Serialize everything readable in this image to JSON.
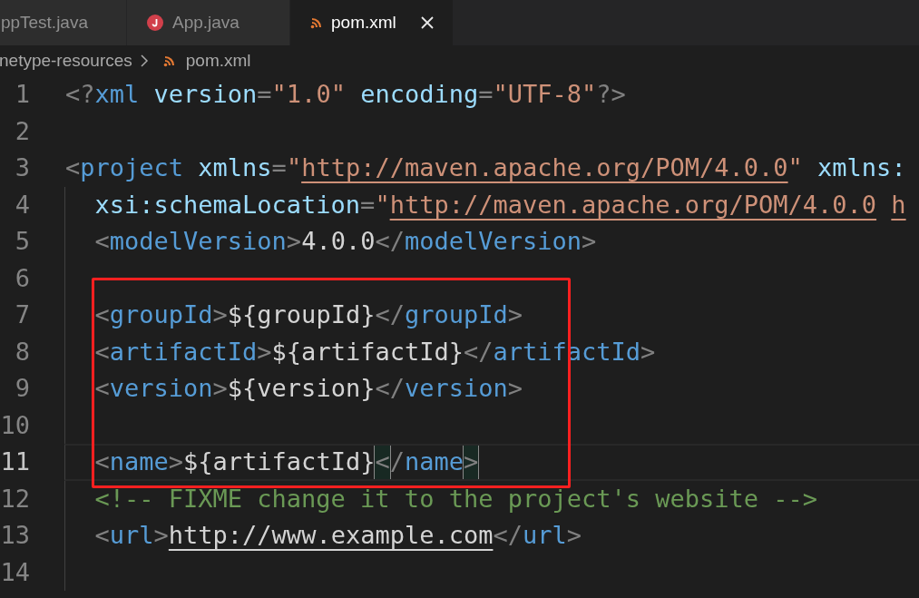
{
  "tabs": [
    {
      "label": "ppTest.java",
      "selected": false
    },
    {
      "label": "App.java",
      "selected": false
    },
    {
      "label": "pom.xml",
      "selected": true
    }
  ],
  "breadcrumb": {
    "folder": "netype-resources",
    "file": "pom.xml"
  },
  "lines": [
    {
      "number": "1",
      "current": false,
      "tokens": [
        {
          "kind": "bracket",
          "text": "<?"
        },
        {
          "kind": "tag",
          "text": "xml"
        },
        {
          "kind": "attr",
          "text": " version"
        },
        {
          "kind": "bracket",
          "text": "="
        },
        {
          "kind": "string",
          "text": "\"1.0\""
        },
        {
          "kind": "attr",
          "text": " encoding"
        },
        {
          "kind": "bracket",
          "text": "="
        },
        {
          "kind": "string",
          "text": "\"UTF-8\""
        },
        {
          "kind": "bracket",
          "text": "?>"
        }
      ]
    },
    {
      "number": "2",
      "current": false
    },
    {
      "number": "3",
      "current": false,
      "tokens": [
        {
          "kind": "bracket",
          "text": "<"
        },
        {
          "kind": "tag",
          "text": "project"
        },
        {
          "kind": "attr",
          "text": " xmlns"
        },
        {
          "kind": "bracket",
          "text": "="
        },
        {
          "kind": "string",
          "text": "\""
        },
        {
          "kind": "string",
          "text": "http://maven.apache.org/POM/4.0.0",
          "link": true
        },
        {
          "kind": "string",
          "text": "\""
        },
        {
          "kind": "attr",
          "text": " xmlns:"
        }
      ]
    },
    {
      "number": "4",
      "current": false,
      "tokens": [
        {
          "kind": "attr",
          "text": "  xsi:schemaLocation"
        },
        {
          "kind": "bracket",
          "text": "="
        },
        {
          "kind": "string",
          "text": "\""
        },
        {
          "kind": "string",
          "text": "http://maven.apache.org/POM/4.0.0 ",
          "link": true
        },
        {
          "kind": "string",
          "text": "h",
          "link": true
        }
      ]
    },
    {
      "number": "5",
      "current": false,
      "tokens": [
        {
          "kind": "bracket",
          "text": "  <"
        },
        {
          "kind": "tag",
          "text": "modelVersion"
        },
        {
          "kind": "bracket",
          "text": ">"
        },
        {
          "kind": "text",
          "text": "4.0.0"
        },
        {
          "kind": "bracket",
          "text": "</"
        },
        {
          "kind": "tag",
          "text": "modelVersion"
        },
        {
          "kind": "bracket",
          "text": ">"
        }
      ]
    },
    {
      "number": "6",
      "current": false
    },
    {
      "number": "7",
      "current": false,
      "tokens": [
        {
          "kind": "bracket",
          "text": "  <"
        },
        {
          "kind": "tag",
          "text": "groupId"
        },
        {
          "kind": "bracket",
          "text": ">"
        },
        {
          "kind": "text",
          "text": "${groupId}"
        },
        {
          "kind": "bracket",
          "text": "</"
        },
        {
          "kind": "tag",
          "text": "groupId"
        },
        {
          "kind": "bracket",
          "text": ">"
        }
      ]
    },
    {
      "number": "8",
      "current": false,
      "tokens": [
        {
          "kind": "bracket",
          "text": "  <"
        },
        {
          "kind": "tag",
          "text": "artifactId"
        },
        {
          "kind": "bracket",
          "text": ">"
        },
        {
          "kind": "text",
          "text": "${artifactId}"
        },
        {
          "kind": "bracket",
          "text": "</"
        },
        {
          "kind": "tag",
          "text": "artifactId"
        },
        {
          "kind": "bracket",
          "text": ">"
        }
      ]
    },
    {
      "number": "9",
      "current": false,
      "tokens": [
        {
          "kind": "bracket",
          "text": "  <"
        },
        {
          "kind": "tag",
          "text": "version"
        },
        {
          "kind": "bracket",
          "text": ">"
        },
        {
          "kind": "text",
          "text": "${version}"
        },
        {
          "kind": "bracket",
          "text": "</"
        },
        {
          "kind": "tag",
          "text": "version"
        },
        {
          "kind": "bracket",
          "text": ">"
        }
      ]
    },
    {
      "number": "10",
      "current": false
    },
    {
      "number": "11",
      "current": true,
      "tokens": [
        {
          "kind": "bracket",
          "text": "  <"
        },
        {
          "kind": "tag",
          "text": "name"
        },
        {
          "kind": "bracket",
          "text": ">"
        },
        {
          "kind": "text",
          "text": "${artifactId}"
        },
        {
          "kind": "bracket",
          "text": "<",
          "matched": true
        },
        {
          "kind": "bracket",
          "text": "/"
        },
        {
          "kind": "tag",
          "text": "name"
        },
        {
          "kind": "bracket",
          "text": ">",
          "matched": true
        }
      ]
    },
    {
      "number": "12",
      "current": false,
      "tokens": [
        {
          "kind": "comment",
          "text": "  <!-- FIXME change it to the project's website -->"
        }
      ]
    },
    {
      "number": "13",
      "current": false,
      "tokens": [
        {
          "kind": "bracket",
          "text": "  <"
        },
        {
          "kind": "tag",
          "text": "url"
        },
        {
          "kind": "bracket",
          "text": ">"
        },
        {
          "kind": "text",
          "text": "http://www.example.com",
          "link": true
        },
        {
          "kind": "bracket",
          "text": "</"
        },
        {
          "kind": "tag",
          "text": "url"
        },
        {
          "kind": "bracket",
          "text": ">"
        }
      ]
    },
    {
      "number": "14",
      "current": false
    }
  ],
  "annotation": {
    "kind": "frame"
  }
}
